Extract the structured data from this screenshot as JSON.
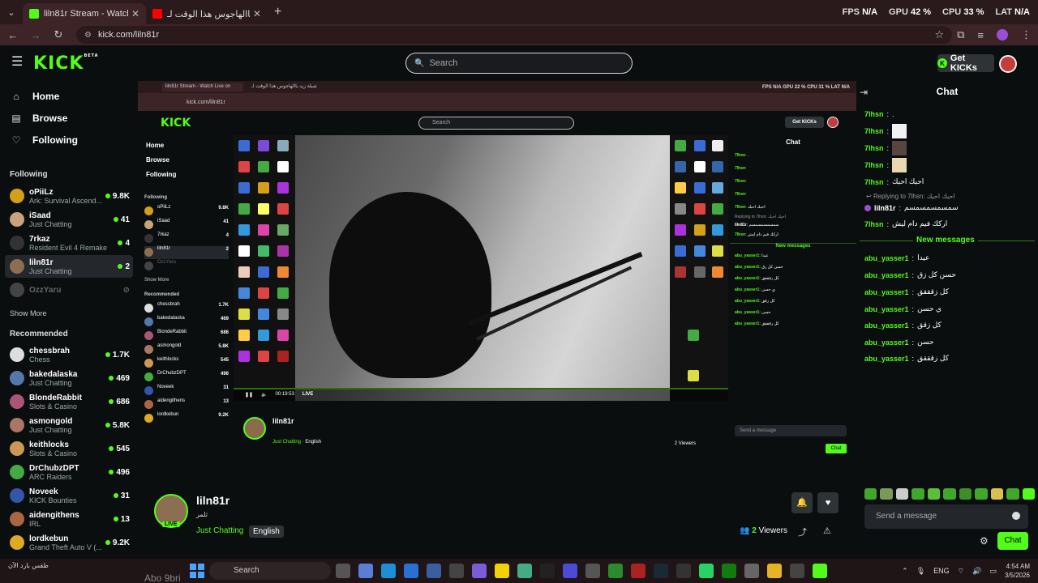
{
  "browser": {
    "tabs": [
      {
        "title": "liln81r Stream - Watch Live on K",
        "active": true
      },
      {
        "title": "شيلة زيد باالهاجوس هذا الوقت لـ",
        "active": false
      }
    ],
    "new_tab": "+",
    "stats": {
      "fps_label": "FPS",
      "fps_value": "N/A",
      "gpu_label": "GPU",
      "gpu_value": "42 %",
      "cpu_label": "CPU",
      "cpu_value": "33 %",
      "lat_label": "LAT",
      "lat_value": "N/A"
    },
    "url": "kick.com/liln81r"
  },
  "header": {
    "logo": "KICK",
    "logo_sup": "BETA",
    "search_placeholder": "Search",
    "get_kicks": "Get KICKs"
  },
  "sidebar": {
    "nav": [
      {
        "label": "Home",
        "icon": "home-icon"
      },
      {
        "label": "Browse",
        "icon": "browse-icon"
      },
      {
        "label": "Following",
        "icon": "heart-icon"
      }
    ],
    "following_title": "Following",
    "following": [
      {
        "name": "oPiiLz",
        "category": "Ark: Survival Ascend...",
        "viewers": "9.8K",
        "color": "#d4a017"
      },
      {
        "name": "iSaad",
        "category": "Just Chatting",
        "viewers": "41",
        "color": "#c9a27e"
      },
      {
        "name": "7rkaz",
        "category": "Resident Evil 4 Remake",
        "viewers": "4",
        "color": "#333333"
      },
      {
        "name": "liln81r",
        "category": "Just Chatting",
        "viewers": "2",
        "color": "#8c6e50"
      },
      {
        "name": "OzzYaru",
        "category": "",
        "viewers": "",
        "color": "#444444"
      }
    ],
    "show_more": "Show More",
    "recommended_title": "Recommended",
    "recommended": [
      {
        "name": "chessbrah",
        "category": "Chess",
        "viewers": "1.7K",
        "color": "#dddddd"
      },
      {
        "name": "bakedalaska",
        "category": "Just Chatting",
        "viewers": "469",
        "color": "#5577aa"
      },
      {
        "name": "BlondeRabbit",
        "category": "Slots & Casino",
        "viewers": "686",
        "color": "#aa5577"
      },
      {
        "name": "asmongold",
        "category": "Just Chatting",
        "viewers": "5.8K",
        "color": "#aa7766"
      },
      {
        "name": "keithlocks",
        "category": "Slots & Casino",
        "viewers": "545",
        "color": "#cc9955"
      },
      {
        "name": "DrChubzDPT",
        "category": "ARC Raiders",
        "viewers": "496",
        "color": "#44aa44"
      },
      {
        "name": "Noveek",
        "category": "KICK Bounties",
        "viewers": "31",
        "color": "#3355aa"
      },
      {
        "name": "aidengithens",
        "category": "IRL",
        "viewers": "13",
        "color": "#aa6644"
      },
      {
        "name": "lordkebun",
        "category": "Grand Theft Auto V (...",
        "viewers": "9.2K",
        "color": "#ddaa22"
      }
    ]
  },
  "nested": {
    "tab1": "liln81r Stream - Watch Live on",
    "tab2": "شيلة زيد باالهاجوس هذا الوقت لـ",
    "url": "kick.com/liln81r",
    "search": "Search",
    "get_kicks": "Get KICKs",
    "stats": "FPS N/A   GPU 22 %   CPU 31 %   LAT N/A",
    "nav": [
      "Home",
      "Browse",
      "Following"
    ],
    "following_title": "Following",
    "recommended_title": "Recommended",
    "show_more": "Show More",
    "time": "00:19:53",
    "live": "LIVE",
    "streamer": "liln81r",
    "category": "Just Chatting",
    "language": "English",
    "viewers": "2 Viewers",
    "chat_title": "Chat",
    "send_placeholder": "Send a message",
    "chat_button": "Chat",
    "new_messages": "New messages"
  },
  "chat": {
    "title": "Chat",
    "messages_top": [
      {
        "user": "7lhsn",
        "text": "."
      },
      {
        "user": "7lhsn",
        "text": ""
      },
      {
        "user": "7lhsn",
        "text": ""
      },
      {
        "user": "7lhsn",
        "text": ""
      },
      {
        "user": "7lhsn",
        "text": "احبك احبك"
      }
    ],
    "replying": "Replying to 7lhsn: احبك احبك",
    "reply_msg": {
      "user": "liln81r",
      "text": "سمسمسمسمسم"
    },
    "last_top": {
      "user": "7lhsn",
      "text": "اركك فيم دام ليش"
    },
    "new_messages": "New messages",
    "messages_new": [
      {
        "user": "abu_yasser1",
        "text": "عيدا"
      },
      {
        "user": "abu_yasser1",
        "text": "حسن كل زق"
      },
      {
        "user": "abu_yasser1",
        "text": "كل زقققق"
      },
      {
        "user": "abu_yasser1",
        "text": "ي حسن"
      },
      {
        "user": "abu_yasser1",
        "text": "كل زقق"
      },
      {
        "user": "abu_yasser1",
        "text": "حسن"
      },
      {
        "user": "abu_yasser1",
        "text": "كل زقققق"
      }
    ],
    "send_placeholder": "Send a message",
    "chat_button": "Chat"
  },
  "stream_info": {
    "name": "liln81r",
    "subtitle": "ثلمر",
    "live": "LIVE",
    "category": "Just Chatting",
    "tag": "English",
    "viewers_count": "2",
    "viewers_label": "Viewers",
    "overlay_name": "Abo 9bri"
  },
  "taskbar": {
    "weather": "طقس بارد الآن",
    "search": "Search",
    "lang": "ENG",
    "time": "4:54 AM",
    "date": "3/5/2026"
  },
  "colors": {
    "kick_green": "#53fc18",
    "bg": "#0b0e0f"
  }
}
